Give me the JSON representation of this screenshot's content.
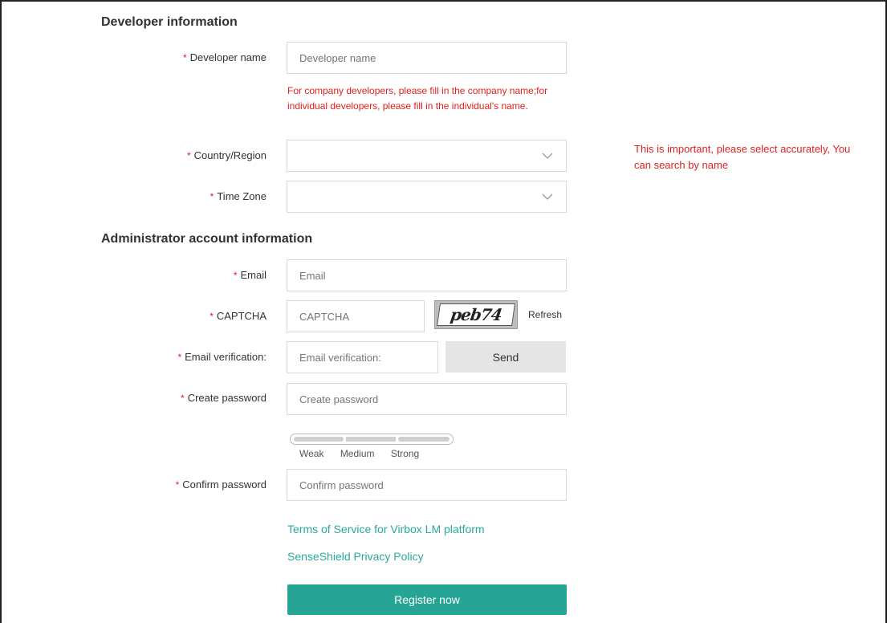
{
  "sections": {
    "developer_title": "Developer information",
    "admin_title": "Administrator account information"
  },
  "required_mark": "*",
  "fields": {
    "developer_name": {
      "label": "Developer name",
      "placeholder": "Developer name"
    },
    "country": {
      "label": "Country/Region",
      "value": ""
    },
    "timezone": {
      "label": "Time Zone",
      "value": ""
    },
    "email": {
      "label": "Email",
      "placeholder": "Email"
    },
    "captcha": {
      "label": "CAPTCHA",
      "placeholder": "CAPTCHA",
      "image_text": "peb74",
      "refresh_label": "Refresh"
    },
    "email_verification": {
      "label": "Email verification:",
      "placeholder": "Email verification:",
      "send_label": "Send"
    },
    "create_password": {
      "label": "Create password",
      "placeholder": "Create password"
    },
    "confirm_password": {
      "label": "Confirm password",
      "placeholder": "Confirm password"
    }
  },
  "developer_name_hint": "For company developers, please fill in the company name;for individual developers, please fill in the individual's name.",
  "country_note": "This is important, please select accurately, You can search by name",
  "password_strength": {
    "levels": [
      "Weak",
      "Medium",
      "Strong"
    ]
  },
  "links": {
    "terms": "Terms of Service for Virbox LM platform",
    "privacy": "SenseShield Privacy Policy"
  },
  "register_label": "Register now",
  "colors": {
    "accent": "#26a595",
    "link": "#2ba89a",
    "error": "#e02020"
  },
  "icons": {
    "select_toggle": "chevron-down-icon",
    "refresh_captcha": "refresh"
  }
}
